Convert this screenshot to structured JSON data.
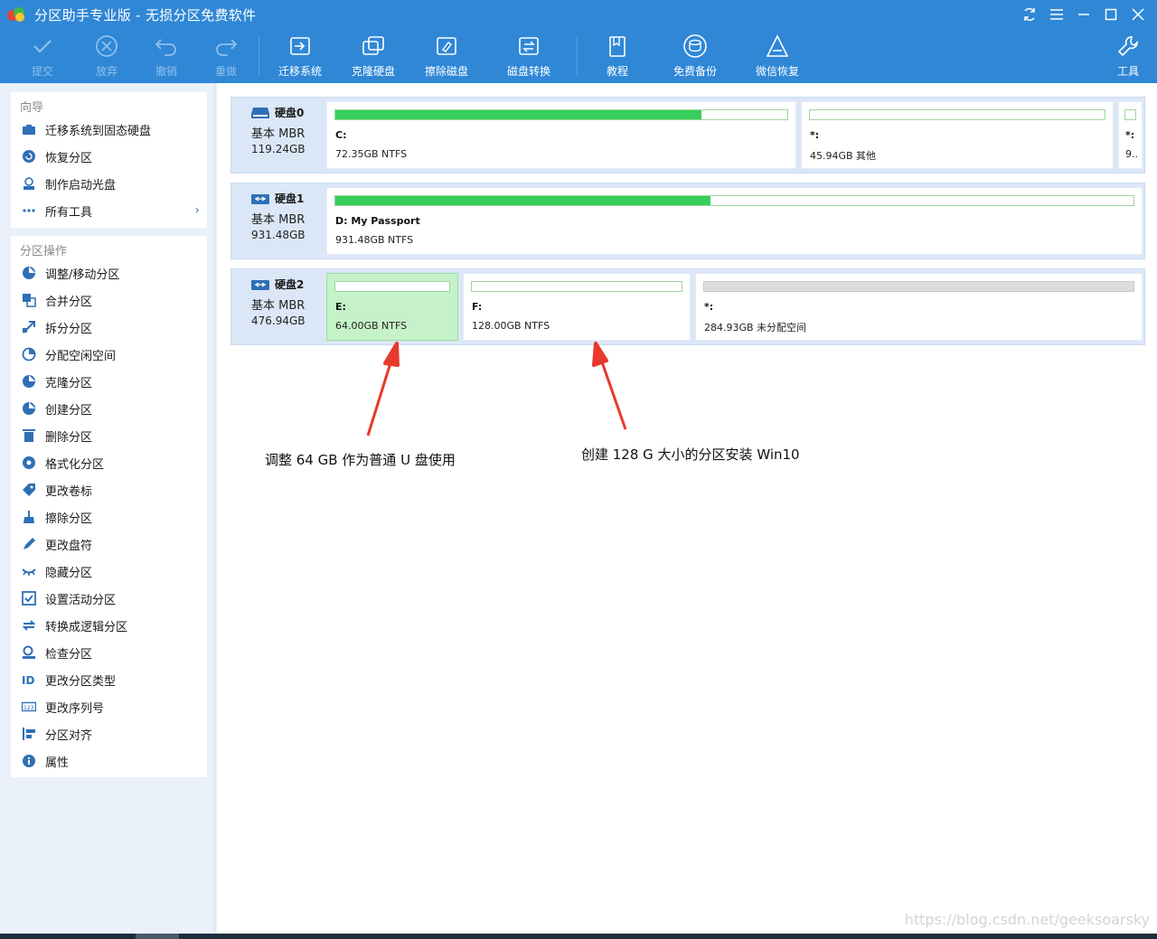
{
  "window": {
    "title": "分区助手专业版 - 无损分区免费软件",
    "controls": [
      "refresh-icon",
      "menu-icon",
      "minimize-icon",
      "maximize-icon",
      "close-icon"
    ]
  },
  "toolbar": {
    "commit": "提交",
    "discard": "放弃",
    "undo": "撤销",
    "redo": "重做",
    "migrate_os": "迁移系统",
    "clone_disk": "克隆硬盘",
    "wipe_disk": "擦除磁盘",
    "disk_convert": "磁盘转换",
    "tutorial": "教程",
    "free_backup": "免费备份",
    "wechat_recover": "微信恢复",
    "tools": "工具"
  },
  "sidebar": {
    "wizard_title": "向导",
    "wizard_items": [
      {
        "label": "迁移系统到固态硬盘",
        "icon": "migrate-icon"
      },
      {
        "label": "恢复分区",
        "icon": "recover-icon"
      },
      {
        "label": "制作启动光盘",
        "icon": "bootdisk-icon"
      },
      {
        "label": "所有工具",
        "icon": "more-icon"
      }
    ],
    "ops_title": "分区操作",
    "ops_items": [
      {
        "label": "调整/移动分区",
        "icon": "resize-icon"
      },
      {
        "label": "合并分区",
        "icon": "merge-icon"
      },
      {
        "label": "拆分分区",
        "icon": "split-icon"
      },
      {
        "label": "分配空闲空间",
        "icon": "allocate-icon"
      },
      {
        "label": "克隆分区",
        "icon": "clone-icon"
      },
      {
        "label": "创建分区",
        "icon": "create-icon"
      },
      {
        "label": "删除分区",
        "icon": "delete-icon"
      },
      {
        "label": "格式化分区",
        "icon": "format-icon"
      },
      {
        "label": "更改卷标",
        "icon": "label-icon"
      },
      {
        "label": "擦除分区",
        "icon": "wipe-icon"
      },
      {
        "label": "更改盘符",
        "icon": "letter-icon"
      },
      {
        "label": "隐藏分区",
        "icon": "hide-icon"
      },
      {
        "label": "设置活动分区",
        "icon": "active-icon"
      },
      {
        "label": "转换成逻辑分区",
        "icon": "convert-icon"
      },
      {
        "label": "检查分区",
        "icon": "check-icon"
      },
      {
        "label": "更改分区类型",
        "icon": "id-icon"
      },
      {
        "label": "更改序列号",
        "icon": "serial-icon"
      },
      {
        "label": "分区对齐",
        "icon": "align-icon"
      },
      {
        "label": "属性",
        "icon": "info-icon"
      }
    ]
  },
  "disks": [
    {
      "name": "硬盘0",
      "type": "基本 MBR",
      "size": "119.24GB",
      "partitions": [
        {
          "label": "C:",
          "info": "72.35GB NTFS",
          "used_fraction": 0.81
        },
        {
          "label": "*:",
          "info": "45.94GB 其他",
          "used_fraction": 0
        },
        {
          "label": "*:",
          "info": "9..",
          "used_fraction": 0
        }
      ]
    },
    {
      "name": "硬盘1",
      "type": "基本 MBR",
      "size": "931.48GB",
      "partitions": [
        {
          "label": "D: My Passport",
          "info": "931.48GB NTFS",
          "used_fraction": 0.47
        }
      ]
    },
    {
      "name": "硬盘2",
      "type": "基本 MBR",
      "size": "476.94GB",
      "partitions": [
        {
          "label": "E:",
          "info": "64.00GB NTFS",
          "used_fraction": 0,
          "selected": true
        },
        {
          "label": "F:",
          "info": "128.00GB NTFS",
          "used_fraction": 0
        },
        {
          "label": "*:",
          "info": "284.93GB 未分配空间",
          "used_fraction": 0,
          "unallocated": true
        }
      ]
    }
  ],
  "annotations": {
    "left": "调整 64 GB 作为普通 U 盘使用",
    "right": "创建 128 G 大小的分区安装 Win10",
    "arrow_color": "#e8392c"
  },
  "watermark": "https://blog.csdn.net/geeksoarsky",
  "colors": {
    "titlebar": "#2f87d6",
    "used_bar": "#37cf59",
    "selected_partition": "#c6f2c9"
  }
}
